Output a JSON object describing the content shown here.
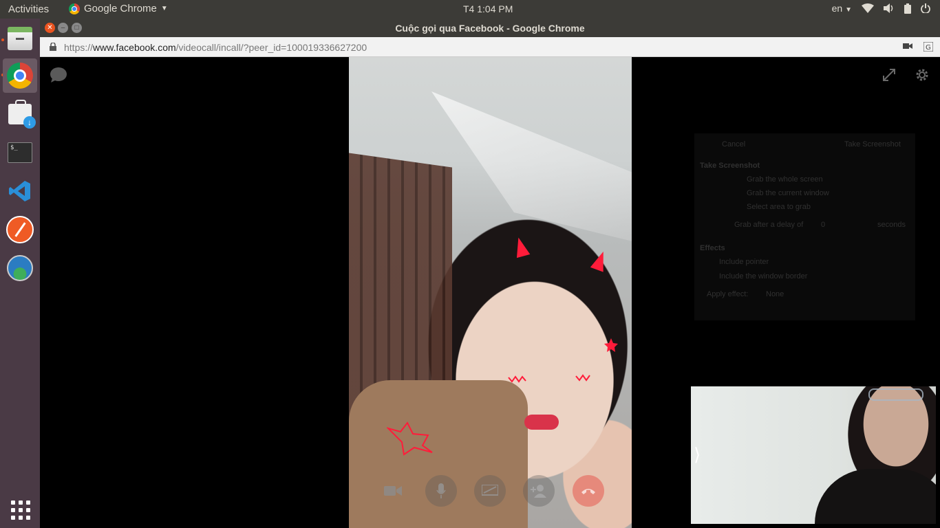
{
  "top_panel": {
    "activities": "Activities",
    "app_name": "Google Chrome",
    "clock": "T4  1:04 PM",
    "language": "en"
  },
  "window": {
    "title": "Cuộc gọi qua Facebook - Google Chrome"
  },
  "urlbar": {
    "scheme": "https://",
    "host": "www.facebook.com",
    "path": "/videocall/incall/?peer_id=100019336627200"
  },
  "launcher": {
    "items": [
      "files-icon",
      "chrome-icon",
      "software-center-icon",
      "terminal-icon",
      "vscode-icon",
      "postman-icon",
      "shotwell-icon"
    ]
  },
  "call": {
    "controls": [
      "video-toggle-icon",
      "mic-icon",
      "screen-share-icon",
      "add-person-icon",
      "end-call-icon"
    ],
    "self_view_toggle": "⟩"
  },
  "screenshot_dialog": {
    "cancel": "Cancel",
    "take": "Take Screenshot",
    "heading": "Take Screenshot",
    "opt_whole": "Grab the whole screen",
    "opt_window": "Grab the current window",
    "opt_area": "Select area to grab",
    "delay_label": "Grab after a delay of",
    "delay_value": "0",
    "delay_unit": "seconds",
    "effects_heading": "Effects",
    "include_pointer": "Include pointer",
    "include_border": "Include the window border",
    "apply_effect": "Apply effect:",
    "effect_value": "None"
  },
  "colors": {
    "panel": "#3c3b37",
    "launcher": "#4a3a45",
    "accent": "#e95420"
  }
}
